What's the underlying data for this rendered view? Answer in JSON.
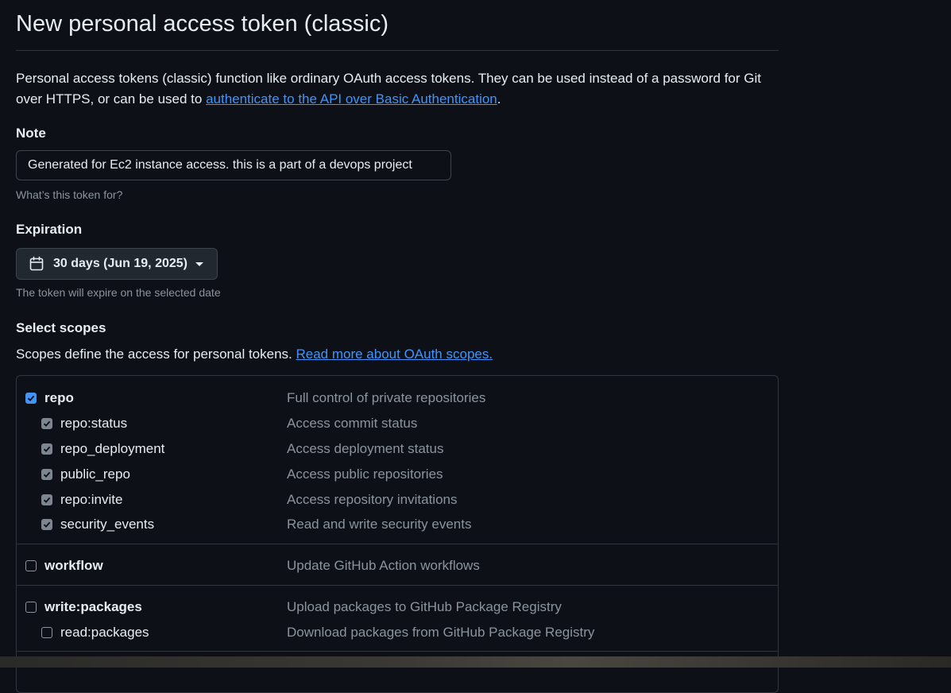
{
  "page": {
    "title": "New personal access token (classic)",
    "intro_text": "Personal access tokens (classic) function like ordinary OAuth access tokens. They can be used instead of a password for Git over HTTPS, or can be used to ",
    "intro_link": "authenticate to the API over Basic Authentication",
    "intro_end": "."
  },
  "note": {
    "label": "Note",
    "value": "Generated for Ec2 instance access. this is a part of a devops project",
    "hint": "What’s this token for?"
  },
  "expiration": {
    "label": "Expiration",
    "selected": "30 days (Jun 19, 2025)",
    "icon": "calendar-icon",
    "hint": "The token will expire on the selected date"
  },
  "scopes": {
    "label": "Select scopes",
    "description": "Scopes define the access for personal tokens. ",
    "link": "Read more about OAuth scopes.",
    "groups": [
      {
        "name": "repo",
        "description": "Full control of private repositories",
        "checked": true,
        "children": [
          {
            "name": "repo:status",
            "description": "Access commit status",
            "checked": true
          },
          {
            "name": "repo_deployment",
            "description": "Access deployment status",
            "checked": true
          },
          {
            "name": "public_repo",
            "description": "Access public repositories",
            "checked": true
          },
          {
            "name": "repo:invite",
            "description": "Access repository invitations",
            "checked": true
          },
          {
            "name": "security_events",
            "description": "Read and write security events",
            "checked": true
          }
        ]
      },
      {
        "name": "workflow",
        "description": "Update GitHub Action workflows",
        "checked": false,
        "children": []
      },
      {
        "name": "write:packages",
        "description": "Upload packages to GitHub Package Registry",
        "checked": false,
        "children": [
          {
            "name": "read:packages",
            "description": "Download packages from GitHub Package Registry",
            "checked": false
          }
        ]
      }
    ]
  },
  "colors": {
    "background": "#0d1117",
    "text": "#e6edf3",
    "muted": "#8b949e",
    "link": "#4493f8",
    "border": "#30363d",
    "checkbox_checked": "#4493f8"
  }
}
